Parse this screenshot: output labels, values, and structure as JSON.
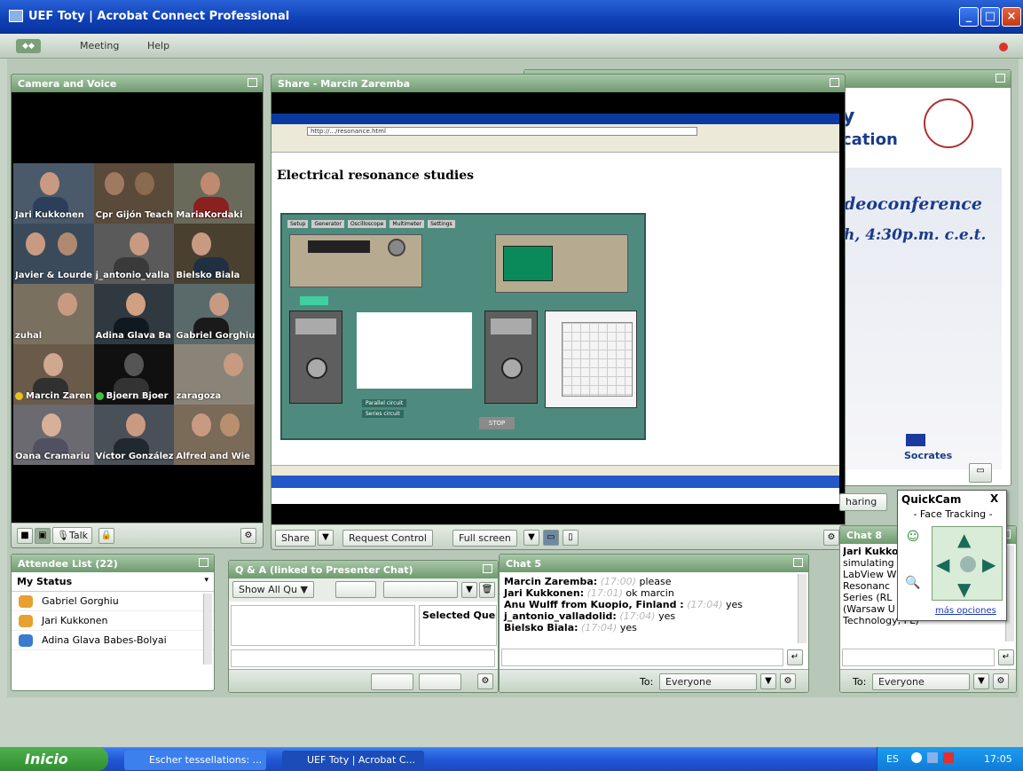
{
  "window": {
    "title": "UEF Toty | Acrobat Connect Professional"
  },
  "menu": {
    "meeting": "Meeting",
    "help": "Help"
  },
  "camera_pod": {
    "title": "Camera and Voice",
    "participants": [
      "Jari Kukkonen",
      "Cpr Gijón Teach",
      "MariaKordaki",
      "Javier & Lourde",
      "j_antonio_valla",
      "Bielsko Biala",
      "zuhal",
      "Adina Glava Ba",
      "Gabriel Gorghiu",
      "Marcin Zaren",
      "Bjoern Bjoer",
      "zaragoza",
      "Oana Cramariu",
      "Víctor González",
      "Alfred and Wie"
    ],
    "talk_label": "Talk"
  },
  "share_pod": {
    "title": "Share - Marcin Zaremba",
    "page_heading": "Electrical resonance studies",
    "buttons": {
      "share": "Share",
      "request_control": "Request Control",
      "full_screen": "Full screen"
    },
    "labview_buttons": [
      "Sharing",
      "Parallel circuit",
      "Series circuit",
      "STOP"
    ],
    "labview_tabs": [
      "Setup",
      "Generator",
      "Oscilloscope",
      "Multimeter",
      "Settings"
    ],
    "inner_address": "http://.../resonance.html"
  },
  "right_slide": {
    "line1": "y",
    "line2": "cation",
    "line3": "deoconference",
    "line4": "h, 4:30p.m.  c.e.t.",
    "socrates": "Socrates"
  },
  "sharing_tab": "haring",
  "quickcam": {
    "title": "QuickCam",
    "subtitle": "- Face Tracking -",
    "more": "más opciones",
    "close": "X"
  },
  "attendee_pod": {
    "title": "Attendee List (22)",
    "status_label": "My Status",
    "attendees": [
      "Gabriel Gorghiu",
      "Jari Kukkonen",
      "Adina Glava Babes-Bolyai"
    ]
  },
  "qa_pod": {
    "title": "Q & A (linked to Presenter Chat)",
    "filter": "Show All Qu",
    "selected": "Selected Ques"
  },
  "chat5": {
    "title": "Chat 5",
    "messages": [
      {
        "name": "Marcin Zaremba:",
        "time": "(17:00)",
        "text": "please"
      },
      {
        "name": "Jari Kukkonen:",
        "time": "(17:01)",
        "text": "ok marcin"
      },
      {
        "name": "Anu Wulff from Kuopio, Finland :",
        "time": "(17:04)",
        "text": "yes"
      },
      {
        "name": "j_antonio_valladolid:",
        "time": "(17:04)",
        "text": "yes"
      },
      {
        "name": "Bielsko Biala:",
        "time": "(17:04)",
        "text": "yes"
      }
    ],
    "to_label": "To:",
    "to_value": "Everyone"
  },
  "chat8": {
    "title": "Chat 8",
    "lines": [
      "Jari Kukko",
      "simulating",
      "LabView W",
      "Resonanc",
      "Series (RL",
      "(Warsaw U",
      "Technology, PL)"
    ],
    "to_label": "To:",
    "to_value": "Everyone"
  },
  "taskbar": {
    "start": "Inicio",
    "tasks": [
      "Escher tessellations: ...",
      "UEF Toty | Acrobat C..."
    ],
    "lang": "ES",
    "clock": "17:05"
  }
}
